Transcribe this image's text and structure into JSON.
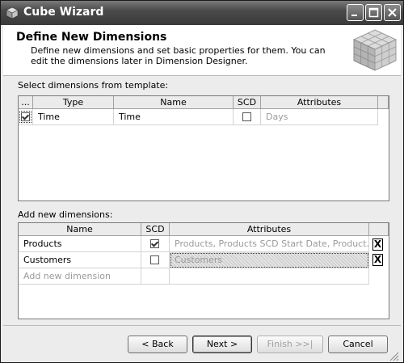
{
  "window": {
    "title": "Cube Wizard"
  },
  "header": {
    "title": "Define New Dimensions",
    "description": "Define new dimensions and set basic properties for them. You can edit the dimensions later in Dimension Designer."
  },
  "template_section": {
    "label": "Select dimensions from template:",
    "columns": [
      "...",
      "Type",
      "Name",
      "SCD",
      "Attributes"
    ],
    "rows": [
      {
        "selected": true,
        "type": "Time",
        "name": "Time",
        "scd": false,
        "attributes": "Days"
      }
    ]
  },
  "new_section": {
    "label": "Add new dimensions:",
    "columns": [
      "Name",
      "SCD",
      "Attributes"
    ],
    "rows": [
      {
        "name": "Products",
        "scd": true,
        "attributes": "Products,  Products SCD Start Date,  Product..."
      },
      {
        "name": "Customers",
        "scd": false,
        "attributes": "Customers"
      }
    ],
    "add_placeholder": "Add new dimension"
  },
  "footer": {
    "back_label": "< Back",
    "next_label": "Next >",
    "finish_label": "Finish >>|",
    "cancel_label": "Cancel"
  }
}
